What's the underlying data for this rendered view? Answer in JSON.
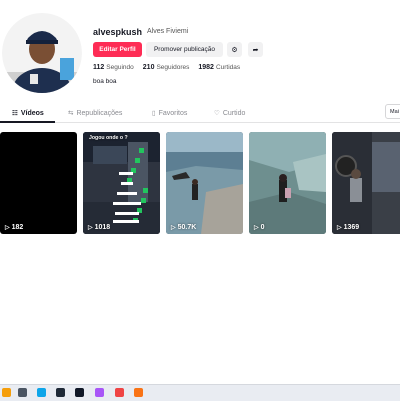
{
  "profile": {
    "username": "alvespkush",
    "nickname": "Alves Fiviemi",
    "bio": "boa boa"
  },
  "buttons": {
    "edit_profile": "Editar Perfil",
    "promote": "Promover publicação",
    "settings_icon": "settings-icon",
    "share_icon": "share-icon"
  },
  "stats": {
    "following_count": "112",
    "following_label": "Seguindo",
    "followers_count": "210",
    "followers_label": "Seguidores",
    "likes_count": "1982",
    "likes_label": "Curtidas"
  },
  "tabs": [
    {
      "label": "Vídeos",
      "icon": "grid-icon",
      "active": true
    },
    {
      "label": "Republicações",
      "icon": "repost-icon",
      "active": false
    },
    {
      "label": "Favoritos",
      "icon": "bookmark-icon",
      "active": false
    },
    {
      "label": "Curtido",
      "icon": "heart-icon",
      "active": false
    }
  ],
  "sort_button": "Mai",
  "videos": [
    {
      "views": "182",
      "label": ""
    },
    {
      "views": "1018",
      "label": "Jogou onde o ?"
    },
    {
      "views": "50.7K",
      "label": ""
    },
    {
      "views": "0",
      "label": ""
    },
    {
      "views": "1369",
      "label": ""
    }
  ],
  "colors": {
    "accent": "#fe2c55",
    "text": "#161823"
  }
}
